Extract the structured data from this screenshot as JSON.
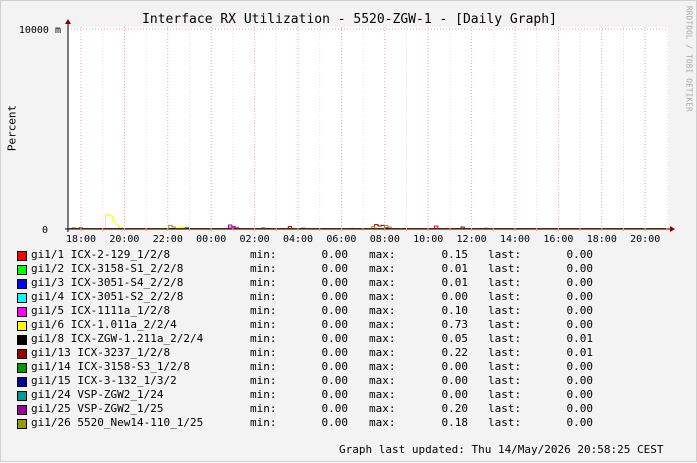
{
  "chart_data": {
    "type": "line",
    "title": "Interface RX Utilization - 5520-ZGW-1 - [Daily Graph]",
    "ylabel": "Percent",
    "xlabel": "",
    "y_ticks": [
      "0",
      "10000 m"
    ],
    "ylim": [
      0,
      10
    ],
    "x_tick_labels": [
      "18:00",
      "20:00",
      "22:00",
      "00:00",
      "02:00",
      "04:00",
      "06:00",
      "08:00",
      "10:00",
      "12:00",
      "14:00",
      "16:00",
      "18:00",
      "20:00"
    ],
    "grid": true,
    "legend_position": "bottom",
    "series": [
      {
        "name": "gi1/1 ICX-2-129_1/2/8",
        "color": "#ff0000",
        "min": "0.00",
        "max": "0.15",
        "last": "0.00",
        "points": [
          [
            1,
            0.05
          ],
          [
            3,
            0.06
          ],
          [
            25,
            0.02
          ],
          [
            58,
            0.05
          ],
          [
            85,
            0.03
          ],
          [
            110,
            0.15
          ],
          [
            125,
            0.04
          ],
          [
            160,
            0.02
          ]
        ]
      },
      {
        "name": "gi1/2 ICX-3158-S1_2/2/8",
        "color": "#00ff00",
        "min": "0.00",
        "max": "0.01",
        "last": "0.00",
        "points": [
          [
            5,
            0.01
          ],
          [
            90,
            0.01
          ]
        ]
      },
      {
        "name": "gi1/3 ICX-3051-S4_2/2/8",
        "color": "#0000ff",
        "min": "0.00",
        "max": "0.01",
        "last": "0.00",
        "points": [
          [
            40,
            0.01
          ],
          [
            100,
            0.01
          ]
        ]
      },
      {
        "name": "gi1/4 ICX-3051-S2_2/2/8",
        "color": "#00ffff",
        "min": "0.00",
        "max": "0.00",
        "last": "0.00",
        "points": []
      },
      {
        "name": "gi1/5 ICX-1111a_1/2/8",
        "color": "#ff00ff",
        "min": "0.00",
        "max": "0.10",
        "last": "0.00",
        "points": [
          [
            48,
            0.1
          ],
          [
            49,
            0.08
          ],
          [
            50,
            0.09
          ]
        ]
      },
      {
        "name": "gi1/6 ICX-1.011a_2/2/4",
        "color": "#ffff00",
        "min": "0.00",
        "max": "0.73",
        "last": "0.00",
        "points": [
          [
            11,
            0.73
          ],
          [
            12,
            0.66
          ],
          [
            13,
            0.4
          ],
          [
            14,
            0.2
          ],
          [
            33,
            0.12
          ],
          [
            34,
            0.08
          ]
        ]
      },
      {
        "name": "gi1/8 ICX-ZGW-1.211a_2/2/4",
        "color": "#000000",
        "min": "0.00",
        "max": "0.05",
        "last": "0.01",
        "points": [
          [
            0,
            0.02
          ],
          [
            15,
            0.03
          ],
          [
            35,
            0.05
          ],
          [
            70,
            0.04
          ],
          [
            95,
            0.05
          ],
          [
            130,
            0.02
          ],
          [
            160,
            0.01
          ]
        ]
      },
      {
        "name": "gi1/13 ICX-3237_1/2/8",
        "color": "#990000",
        "min": "0.00",
        "max": "0.22",
        "last": "0.01",
        "points": [
          [
            66,
            0.12
          ],
          [
            92,
            0.22
          ],
          [
            93,
            0.15
          ],
          [
            94,
            0.18
          ],
          [
            118,
            0.1
          ],
          [
            150,
            0.01
          ]
        ]
      },
      {
        "name": "gi1/14 ICX-3158-S3_1/2/8",
        "color": "#009900",
        "min": "0.00",
        "max": "0.00",
        "last": "0.00",
        "points": []
      },
      {
        "name": "gi1/15 ICX-3-132_1/3/2",
        "color": "#000099",
        "min": "0.00",
        "max": "0.00",
        "last": "0.00",
        "points": []
      },
      {
        "name": "gi1/24 VSP-ZGW2_1/24",
        "color": "#009999",
        "min": "0.00",
        "max": "0.00",
        "last": "0.00",
        "points": []
      },
      {
        "name": "gi1/25 VSP-ZGW2_1/25",
        "color": "#990099",
        "min": "0.00",
        "max": "0.20",
        "last": "0.00",
        "points": [
          [
            48,
            0.2
          ],
          [
            49,
            0.12
          ]
        ]
      },
      {
        "name": "gi1/26 5520_New14-110_1/25",
        "color": "#999900",
        "min": "0.00",
        "max": "0.18",
        "last": "0.00",
        "points": [
          [
            30,
            0.18
          ],
          [
            31,
            0.1
          ],
          [
            91,
            0.12
          ],
          [
            95,
            0.18
          ],
          [
            96,
            0.1
          ]
        ]
      }
    ]
  },
  "legend_labels": {
    "min": "min:",
    "max": "max:",
    "last": "last:"
  },
  "watermark": "RRDTOOL / TOBI OETIKER",
  "last_updated": "Graph last updated: Thu 14/May/2026 20:58:25 CEST",
  "colors": {
    "background": "#f3f3f3",
    "canvas": "#ffffff",
    "grid_minor": "#e0e0e0",
    "grid_major": "#e8a8a8",
    "axis_arrow": "#880000"
  }
}
